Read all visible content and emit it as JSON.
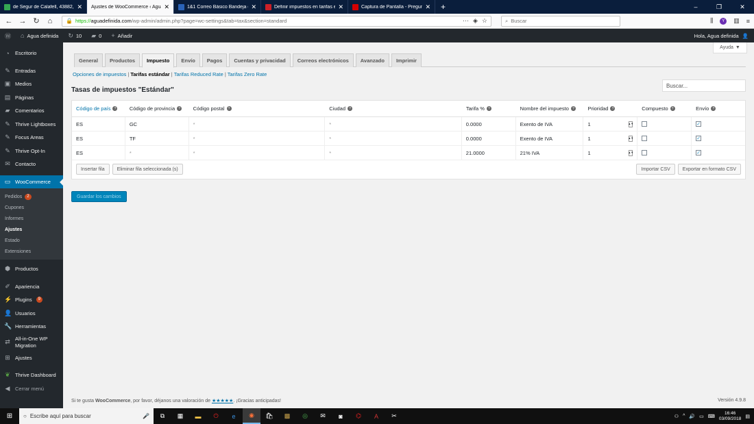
{
  "browser": {
    "tabs": [
      {
        "title": "de Segur de Calafell, 43882, Tarr",
        "active": false,
        "color": "#34a853"
      },
      {
        "title": "Ajustes de WooCommerce ‹ Agua d",
        "active": true,
        "color": "#96588a"
      },
      {
        "title": "1&1 Correo Básico Bandeja de",
        "active": false,
        "color": "#2a63b8"
      },
      {
        "title": "Definir impuestos en tarifas est",
        "active": false,
        "color": "#cc2027"
      },
      {
        "title": "Captura de Pantalla - Pregunta",
        "active": false,
        "color": "#d40000"
      }
    ],
    "url_proto": "https://",
    "url_domain": "aguadefinida.com",
    "url_path": "/wp-admin/admin.php?page=wc-settings&tab=tax&section=standard",
    "search_placeholder": "Buscar"
  },
  "adminbar": {
    "site_name": "Agua definida",
    "updates_count": "10",
    "comments_count": "0",
    "add_new": "Añadir",
    "greeting": "Hola, Agua definida"
  },
  "sidebar": {
    "items_top": [
      "Escritorio",
      "Entradas",
      "Medios",
      "Páginas",
      "Comentarios",
      "Thrive Lightboxes",
      "Focus Areas",
      "Thrive Opt-In",
      "Contacto"
    ],
    "woocommerce": "WooCommerce",
    "submenu": [
      "Pedidos",
      "Cupones",
      "Informes",
      "Ajustes",
      "Estado",
      "Extensiones"
    ],
    "pedidos_badge": "2",
    "productos": "Productos",
    "apariencia": "Apariencia",
    "plugins": "Plugins",
    "plugins_badge": "9",
    "usuarios": "Usuarios",
    "herramientas": "Herramientas",
    "allinone": "All-in-One WP Migration",
    "ajustes": "Ajustes",
    "thrive_dashboard": "Thrive Dashboard",
    "cerrar_menu": "Cerrar menú"
  },
  "help_tab": "Ayuda",
  "tabs": [
    "General",
    "Productos",
    "Impuesto",
    "Envío",
    "Pagos",
    "Cuentas y privacidad",
    "Correos electrónicos",
    "Avanzado",
    "Imprimir"
  ],
  "subsubsub": {
    "options": "Opciones de impuestos",
    "standard": "Tarifas estándar",
    "reduced": "Tarifas Reduced Rate",
    "zero": "Tarifas Zero Rate"
  },
  "section_title": "Tasas de impuestos \"Estándar\"",
  "search_placeholder": "Buscar...",
  "table": {
    "headers": [
      "Código de país",
      "Código de provincia",
      "Código postal",
      "Ciudad",
      "Tarifa %",
      "Nombre del impuesto",
      "Prioridad",
      "Compuesto",
      "Envío"
    ],
    "rows": [
      {
        "country": "ES",
        "state": "GC",
        "postcode": "*",
        "city": "*",
        "rate": "0.0000",
        "name": "Exento de IVA",
        "priority": "1",
        "compound": false,
        "shipping": true
      },
      {
        "country": "ES",
        "state": "TF",
        "postcode": "*",
        "city": "*",
        "rate": "0.0000",
        "name": "Exento de IVA",
        "priority": "1",
        "compound": false,
        "shipping": true
      },
      {
        "country": "ES",
        "state": "*",
        "postcode": "*",
        "city": "*",
        "rate": "21.0000",
        "name": "21% IVA",
        "priority": "1",
        "compound": false,
        "shipping": true
      }
    ],
    "insert_row": "Insertar fila",
    "remove_rows": "Eliminar fila seleccionada (s)",
    "import_csv": "Importar CSV",
    "export_csv": "Exportar en formato CSV"
  },
  "save_button": "Guardar los cambios",
  "footer": {
    "text_before": "Si te gusta ",
    "brand": "WooCommerce",
    "text_middle": ", por favor, déjanos una valoración de ",
    "stars": "★★★★★",
    "text_after": ". ¡Gracias anticipadas!",
    "version": "Versión 4.9.8"
  },
  "taskbar": {
    "search_placeholder": "Escribe aquí para buscar",
    "time": "16:46",
    "date": "03/09/2018"
  },
  "colors": {
    "wp_blue": "#0073aa",
    "admin_dark": "#23282d",
    "badge": "#ca4a1f"
  }
}
